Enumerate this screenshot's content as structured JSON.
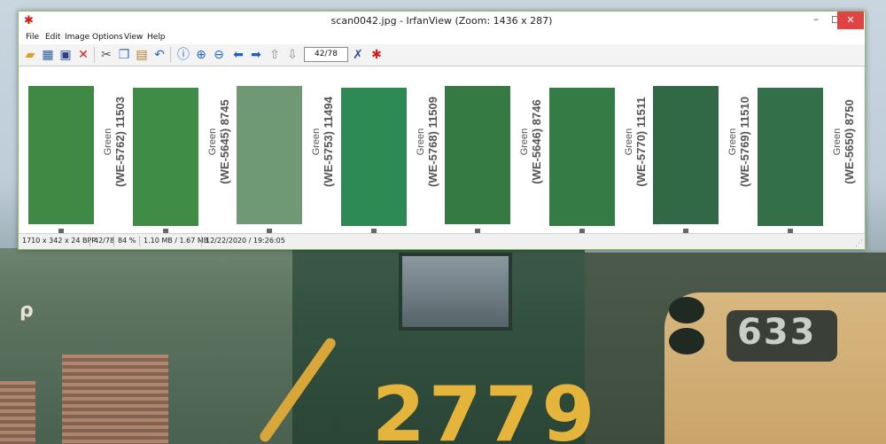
{
  "window": {
    "title": "scan0042.jpg - IrfanView (Zoom: 1436 x 287)",
    "controls": {
      "minimize": "–",
      "maximize": "☐",
      "close": "✕"
    }
  },
  "menu": [
    "File",
    "Edit",
    "Image",
    "Options",
    "View",
    "Help"
  ],
  "toolbar": {
    "page_counter": "42/78",
    "icons": [
      "open-folder-icon",
      "slideshow-icon",
      "save-icon",
      "delete-icon",
      "cut-icon",
      "copy-icon",
      "paste-icon",
      "undo-icon",
      "info-icon",
      "zoom-in-icon",
      "zoom-out-icon",
      "previous-icon",
      "next-icon",
      "first-page-icon",
      "last-page-icon",
      "settings-icon",
      "exit-icon"
    ]
  },
  "swatches": [
    {
      "color": "#3e8a44",
      "label_color": "Green",
      "label_code": "(WE-5762) 11503"
    },
    {
      "color": "#3f8c47",
      "label_color": "Green",
      "label_code": "(WE-5645) 8745"
    },
    {
      "color": "#6f9874",
      "label_color": "Green",
      "label_code": "(WE-5753) 11494"
    },
    {
      "color": "#2c8a52",
      "label_color": "Green",
      "label_code": "(WE-5768) 11509"
    },
    {
      "color": "#357a42",
      "label_color": "Green",
      "label_code": "(WE-5646) 8746"
    },
    {
      "color": "#347c45",
      "label_color": "Green",
      "label_code": "(WE-5770) 11511"
    },
    {
      "color": "#316946",
      "label_color": "Green",
      "label_code": "(WE-5769) 11510"
    },
    {
      "color": "#33704a",
      "label_color": "Green",
      "label_code": "(WE-5650) 8750"
    }
  ],
  "status": {
    "dimensions": "1710 x 342 x 24 BPP",
    "page": "42/78",
    "zoom": "84 %",
    "memory": "1.10 MB / 1.67 MB",
    "datetime": "12/22/2020 / 19:26:05"
  },
  "wallpaper": {
    "loco_number_right": "633",
    "loco_number_center": "2779",
    "loco_text_left": "ρ"
  }
}
